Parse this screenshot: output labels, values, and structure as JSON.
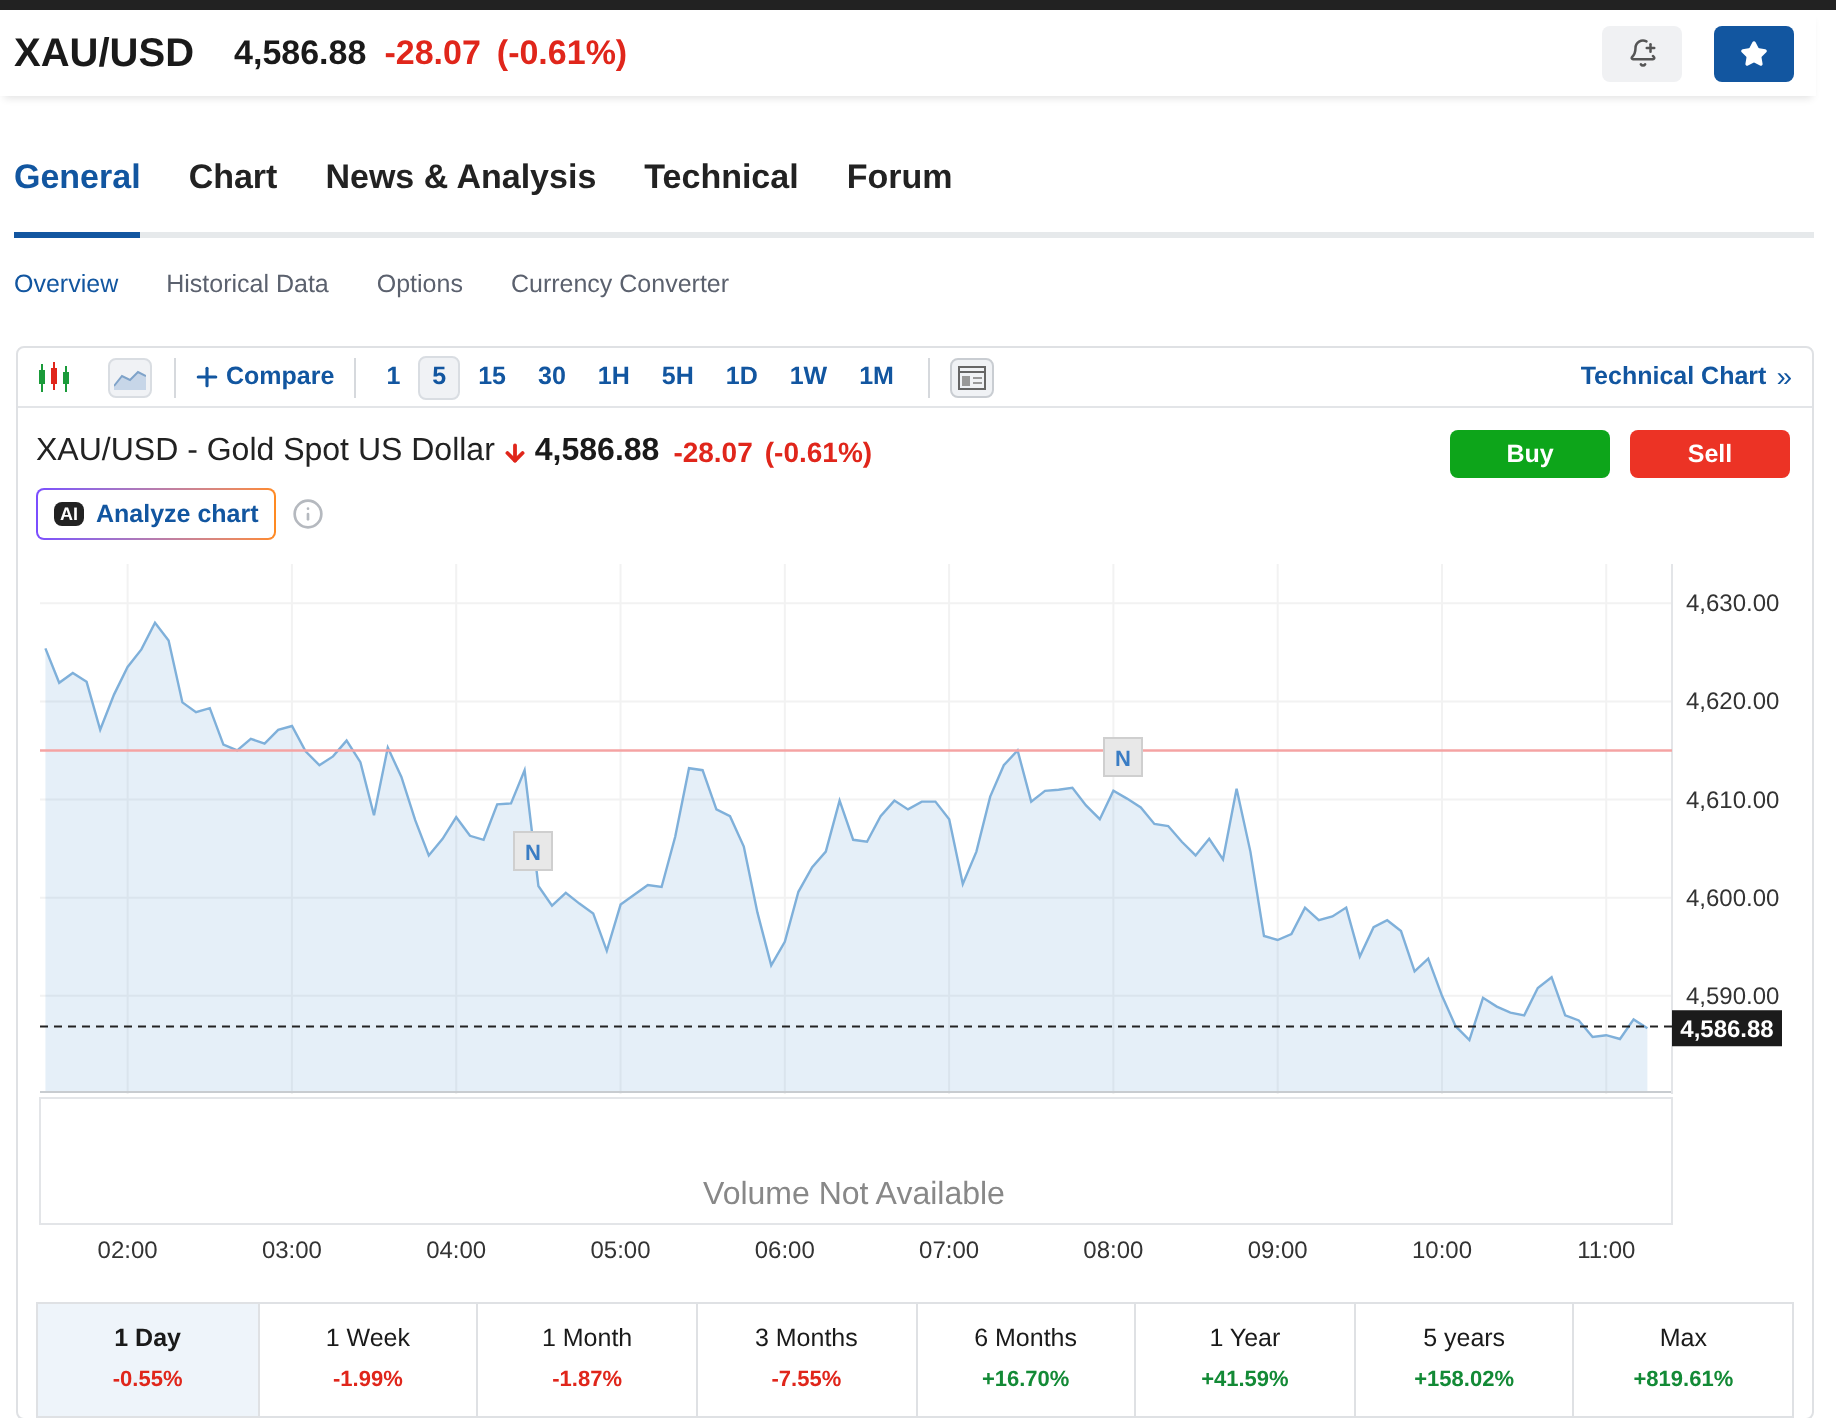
{
  "header": {
    "symbol": "XAU/USD",
    "price": "4,586.88",
    "change": "-28.07",
    "change_pct": "(-0.61%)"
  },
  "tabs": [
    {
      "label": "General",
      "selected": true
    },
    {
      "label": "Chart",
      "selected": false
    },
    {
      "label": "News & Analysis",
      "selected": false
    },
    {
      "label": "Technical",
      "selected": false
    },
    {
      "label": "Forum",
      "selected": false
    }
  ],
  "subtabs": [
    {
      "label": "Overview",
      "selected": true
    },
    {
      "label": "Historical Data",
      "selected": false
    },
    {
      "label": "Options",
      "selected": false
    },
    {
      "label": "Currency Converter",
      "selected": false
    }
  ],
  "toolbar": {
    "compare": "Compare",
    "intervals": [
      {
        "label": "1",
        "selected": false
      },
      {
        "label": "5",
        "selected": true
      },
      {
        "label": "15",
        "selected": false
      },
      {
        "label": "30",
        "selected": false
      },
      {
        "label": "1H",
        "selected": false
      },
      {
        "label": "5H",
        "selected": false
      },
      {
        "label": "1D",
        "selected": false
      },
      {
        "label": "1W",
        "selected": false
      },
      {
        "label": "1M",
        "selected": false
      }
    ],
    "technical_chart": "Technical Chart",
    "chevron": "»"
  },
  "instrument": {
    "title": "XAU/USD - Gold Spot US Dollar",
    "price": "4,586.88",
    "change": "-28.07",
    "change_pct": "(-0.61%)",
    "ai_badge": "AI",
    "analyze": "Analyze chart",
    "buy": "Buy",
    "sell": "Sell"
  },
  "chart": {
    "volume_message": "Volume Not Available",
    "chart_data": {
      "type": "area",
      "x": [
        90,
        95,
        100,
        105,
        110,
        115,
        120,
        125,
        130,
        135,
        140,
        145,
        150,
        155,
        160,
        165,
        170,
        175,
        180,
        185,
        190,
        195,
        200,
        205,
        210,
        215,
        220,
        225,
        230,
        235,
        240,
        245,
        250,
        255,
        260,
        265,
        270,
        275,
        280,
        285,
        290,
        295,
        300,
        305,
        310,
        315,
        320,
        325,
        330,
        335,
        340,
        345,
        350,
        355,
        360,
        365,
        370,
        375,
        380,
        385,
        390,
        395,
        400,
        405,
        410,
        415,
        420,
        425,
        430,
        435,
        440,
        445,
        450,
        455,
        460,
        465,
        470,
        475,
        480,
        485,
        490,
        495,
        500,
        505,
        510,
        515,
        520,
        525,
        530,
        535,
        540,
        545,
        550,
        555,
        560,
        565,
        570,
        575,
        580,
        585,
        590,
        595,
        600,
        605,
        610,
        615,
        620,
        625,
        630,
        635,
        640,
        645,
        650,
        655,
        660,
        665,
        670,
        675
      ],
      "series": [
        {
          "color": "#7fb0da",
          "values": [
            4625.4,
            4621.9,
            4622.9,
            4622,
            4617.1,
            4620.7,
            4623.5,
            4625.3,
            4628,
            4626.2,
            4619.9,
            4618.9,
            4619.3,
            4615.6,
            4615,
            4616.2,
            4615.7,
            4617.1,
            4617.5,
            4614.9,
            4613.5,
            4614.4,
            4616,
            4613.8,
            4608.4,
            4615.3,
            4612.3,
            4607.9,
            4604.3,
            4606,
            4608.2,
            4606.3,
            4605.9,
            4609.5,
            4609.6,
            4613,
            4601.2,
            4599.2,
            4600.5,
            4599.4,
            4598.4,
            4594.6,
            4599.3,
            4600.3,
            4601.3,
            4601.1,
            4606.2,
            4613.2,
            4613,
            4609,
            4608.3,
            4605.2,
            4598.5,
            4593.1,
            4595.5,
            4600.6,
            4603.1,
            4604.7,
            4609.9,
            4605.9,
            4605.7,
            4608.3,
            4609.9,
            4609,
            4609.8,
            4609.8,
            4608,
            4601.4,
            4604.7,
            4610.3,
            4613.5,
            4615,
            4609.8,
            4610.9,
            4611,
            4611.2,
            4609.4,
            4608,
            4610.9,
            4610.1,
            4609.2,
            4607.5,
            4607.3,
            4605.7,
            4604.3,
            4606,
            4603.9,
            4611.1,
            4604.7,
            4596.1,
            4595.7,
            4596.3,
            4599,
            4597.7,
            4598.1,
            4599,
            4594,
            4597,
            4597.7,
            4596.6,
            4592.5,
            4593.8,
            4590,
            4586.9,
            4585.5,
            4589.8,
            4588.9,
            4588.3,
            4588,
            4590.8,
            4591.9,
            4588,
            4587.5,
            4585.8,
            4586,
            4585.6,
            4587.6,
            4586.7
          ]
        }
      ],
      "xlim": [
        88,
        684
      ],
      "ylim": [
        4580,
        4634
      ],
      "xticks": [
        {
          "value": 120,
          "label": "02:00"
        },
        {
          "value": 180,
          "label": "03:00"
        },
        {
          "value": 240,
          "label": "04:00"
        },
        {
          "value": 300,
          "label": "05:00"
        },
        {
          "value": 360,
          "label": "06:00"
        },
        {
          "value": 420,
          "label": "07:00"
        },
        {
          "value": 480,
          "label": "08:00"
        },
        {
          "value": 540,
          "label": "09:00"
        },
        {
          "value": 600,
          "label": "10:00"
        },
        {
          "value": 660,
          "label": "11:00"
        }
      ],
      "yticks": [
        {
          "value": 4590,
          "label": "4,590.00"
        },
        {
          "value": 4600,
          "label": "4,600.00"
        },
        {
          "value": 4610,
          "label": "4,610.00"
        },
        {
          "value": 4620,
          "label": "4,620.00"
        },
        {
          "value": 4630,
          "label": "4,630.00"
        }
      ],
      "grid": true,
      "ref_lines": [
        {
          "axis": "y",
          "value": 4615,
          "color": "#f5a3a3"
        },
        {
          "axis": "y",
          "value": 4586.88,
          "color": "#222222"
        }
      ]
    },
    "price_label": "4,586.88",
    "news_markers": [
      "N",
      "N"
    ]
  },
  "periods": [
    {
      "label": "1 Day",
      "change": "-0.55%",
      "color": "#e0261b",
      "selected": true
    },
    {
      "label": "1 Week",
      "change": "-1.99%",
      "color": "#e0261b",
      "selected": false
    },
    {
      "label": "1 Month",
      "change": "-1.87%",
      "color": "#e0261b",
      "selected": false
    },
    {
      "label": "3 Months",
      "change": "-7.55%",
      "color": "#e0261b",
      "selected": false
    },
    {
      "label": "6 Months",
      "change": "+16.70%",
      "color": "#138a36",
      "selected": false
    },
    {
      "label": "1 Year",
      "change": "+41.59%",
      "color": "#138a36",
      "selected": false
    },
    {
      "label": "5 years",
      "change": "+158.02%",
      "color": "#138a36",
      "selected": false
    },
    {
      "label": "Max",
      "change": "+819.61%",
      "color": "#138a36",
      "selected": false
    }
  ]
}
